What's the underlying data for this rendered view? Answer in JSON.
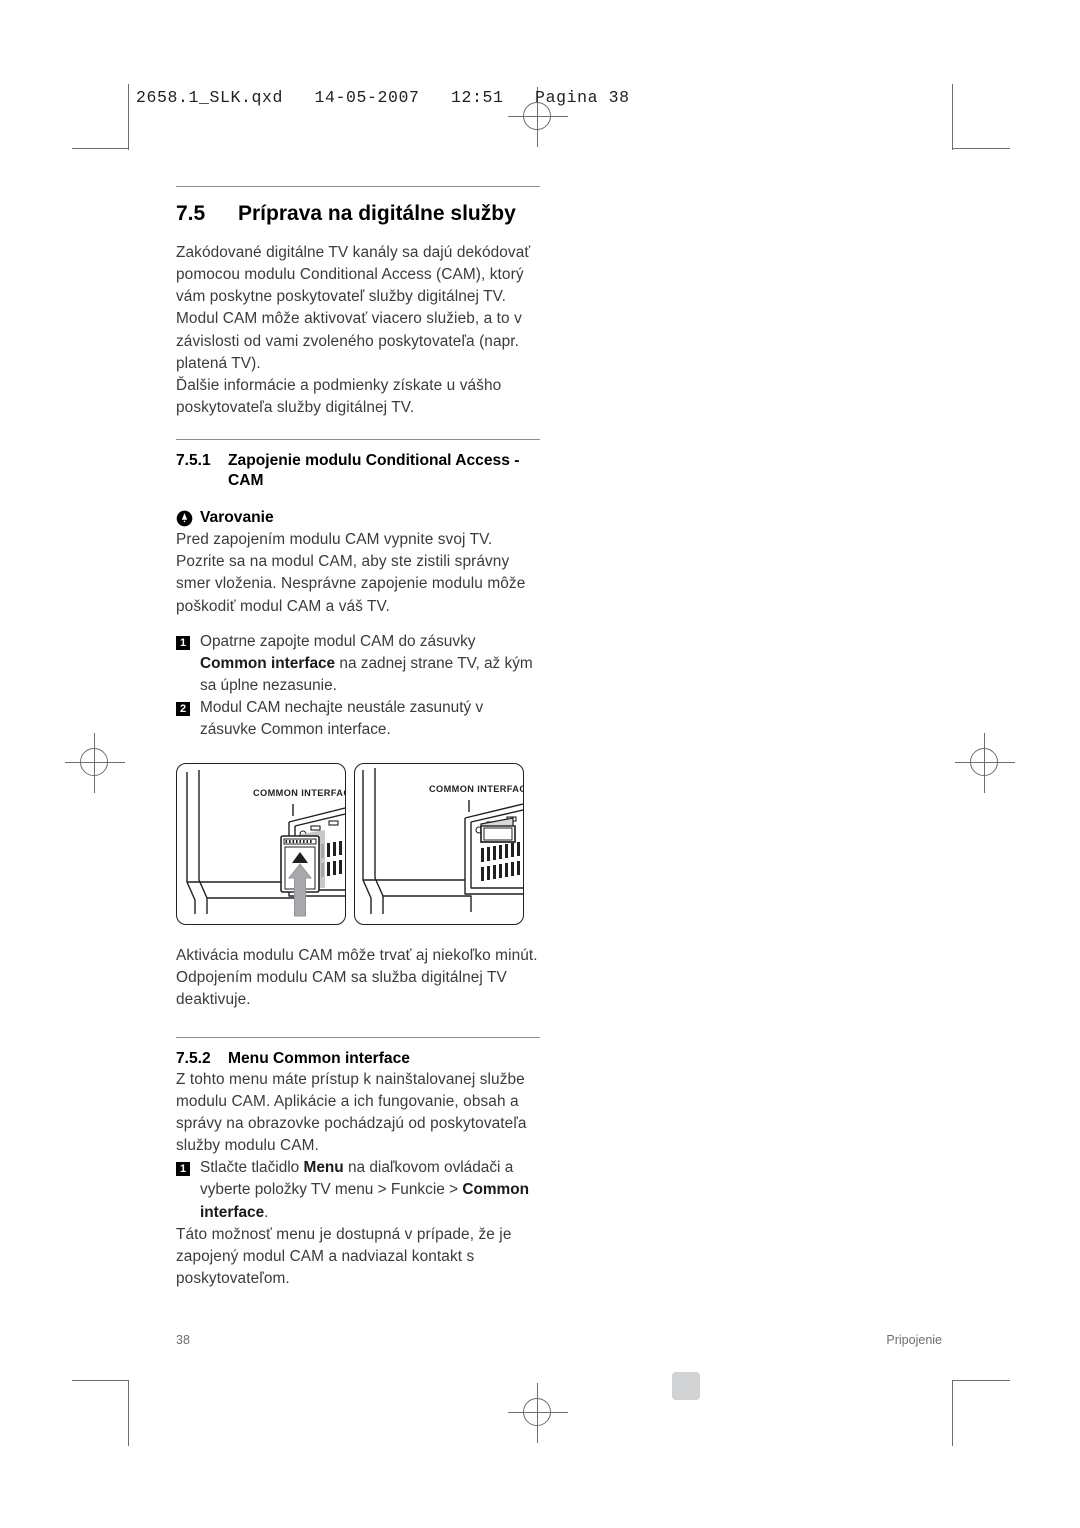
{
  "print_marks": {
    "file_stamp": "2658.1_SLK.qxd   14-05-2007   12:51   Pagina 38"
  },
  "section": {
    "number": "7.5",
    "title": "Príprava na digitálne služby",
    "intro_paragraph_1": "Zakódované digitálne TV kanály sa dajú dekódovať pomocou modulu Conditional Access (CAM), ktorý vám poskytne poskytovateľ služby digitálnej TV. Modul CAM môže aktivovať viacero služieb, a to v závislosti od vami zvoleného poskytovateľa (napr. platená TV).",
    "intro_paragraph_2": "Ďalšie informácie a podmienky získate u vášho poskytovateľa služby digitálnej TV."
  },
  "subsection_1": {
    "number": "7.5.1",
    "title": "Zapojenie modulu Conditional Access - CAM",
    "warning": {
      "icon": "warning-icon",
      "label": "Varovanie",
      "text": "Pred zapojením modulu CAM vypnite svoj TV. Pozrite sa na modul CAM, aby ste zistili správny smer vloženia. Nesprávne zapojenie modulu môže poškodiť modul CAM a váš TV."
    },
    "steps": [
      {
        "number": "1",
        "text_before": "Opatrne zapojte modul CAM do zásuvky ",
        "bold": "Common interface",
        "text_after": " na zadnej strane TV, až kým sa úplne nezasunie."
      },
      {
        "number": "2",
        "text_before": "Modul CAM nechajte neustále zasunutý v zásuvke Common interface.",
        "bold": "",
        "text_after": ""
      }
    ],
    "figure": {
      "panel_left_label": "COMMON INTERFACE",
      "panel_right_label": "COMMON INTERFACE"
    },
    "after_figure_text": "Aktivácia modulu CAM môže trvať aj niekoľko minút. Odpojením modulu CAM sa služba digitálnej TV deaktivuje."
  },
  "subsection_2": {
    "number": "7.5.2",
    "title": "Menu Common interface",
    "paragraph": "Z tohto menu máte prístup k nainštalovanej službe modulu CAM. Aplikácie a ich fungovanie, obsah a správy na obrazovke pochádzajú od poskytovateľa služby modulu CAM.",
    "steps": [
      {
        "number": "1",
        "part_1": "Stlačte tlačidlo ",
        "bold_1": "Menu",
        "part_2": " na diaľkovom ovládači a vyberte položky TV menu > Funkcie > ",
        "bold_2": "Common interface",
        "part_3": "."
      }
    ],
    "closing_text": "Táto možnosť menu je dostupná v prípade, že je zapojený modul CAM a nadviazal kontakt s poskytovateľom."
  },
  "footer": {
    "page_number": "38",
    "chapter": "Pripojenie"
  },
  "colors": {
    "text": "#3b3b3b",
    "heading": "#000000",
    "rule": "#8c8c8c",
    "mark": "#6d6e71",
    "swatch": "#d0d2d3"
  }
}
